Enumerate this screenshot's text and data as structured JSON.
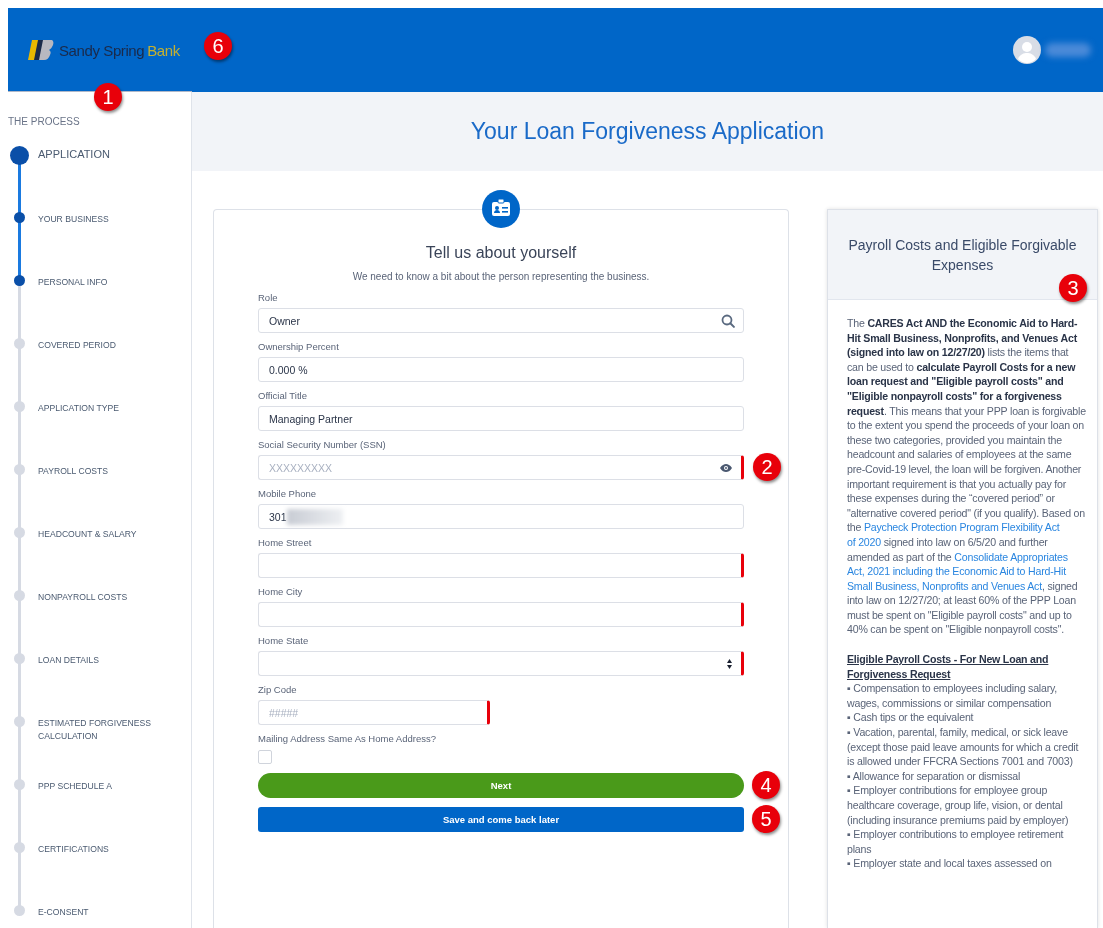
{
  "header": {
    "logo": {
      "text": "Sandy Spring",
      "accent": "Bank"
    },
    "user": {
      "redacted": true
    }
  },
  "sidebar": {
    "title": "THE PROCESS",
    "steps": [
      {
        "label": "APPLICATION",
        "kind": "major",
        "completed": true
      },
      {
        "label": "YOUR BUSINESS",
        "kind": "minor",
        "completed": true
      },
      {
        "label": "PERSONAL INFO",
        "kind": "minor",
        "completed": true
      },
      {
        "label": "COVERED PERIOD",
        "kind": "minor",
        "completed": false
      },
      {
        "label": "APPLICATION TYPE",
        "kind": "minor",
        "completed": false
      },
      {
        "label": "PAYROLL COSTS",
        "kind": "minor",
        "completed": false
      },
      {
        "label": "HEADCOUNT & SALARY",
        "kind": "minor",
        "completed": false
      },
      {
        "label": "NONPAYROLL COSTS",
        "kind": "minor",
        "completed": false
      },
      {
        "label": "LOAN DETAILS",
        "kind": "minor",
        "completed": false
      },
      {
        "label": "ESTIMATED FORGIVENESS CALCULATION",
        "kind": "minor",
        "completed": false
      },
      {
        "label": "PPP SCHEDULE A",
        "kind": "minor",
        "completed": false
      },
      {
        "label": "CERTIFICATIONS",
        "kind": "minor",
        "completed": false
      },
      {
        "label": "E-CONSENT",
        "kind": "minor",
        "completed": false
      }
    ]
  },
  "page_title": "Your Loan Forgiveness Application",
  "form": {
    "heading": "Tell us about yourself",
    "subtitle": "We need to know a bit about the person representing the business.",
    "fields": [
      {
        "label": "Role",
        "kind": "search",
        "value": "Owner",
        "required": false
      },
      {
        "label": "Ownership Percent",
        "kind": "text",
        "value": "0.000 %",
        "required": false
      },
      {
        "label": "Official Title",
        "kind": "text",
        "value": "Managing Partner",
        "required": false
      },
      {
        "label": "Social Security Number (SSN)",
        "kind": "secret",
        "placeholder": "XXXXXXXXX",
        "required": true
      },
      {
        "label": "Mobile Phone",
        "kind": "text",
        "value": "301",
        "redacted": true,
        "required": false
      },
      {
        "label": "Home Street",
        "kind": "text",
        "required": true
      },
      {
        "label": "Home City",
        "kind": "text",
        "required": true
      },
      {
        "label": "Home State",
        "kind": "select",
        "required": true
      },
      {
        "label": "Zip Code",
        "kind": "short",
        "placeholder": "#####",
        "required": true
      }
    ],
    "checkbox": {
      "label": "Mailing Address Same As Home Address?",
      "checked": false
    },
    "buttons": [
      {
        "label": "Next",
        "kind": "primary"
      },
      {
        "label": "Save and come back later",
        "kind": "secondary"
      }
    ]
  },
  "info_panel": {
    "title": "Payroll Costs and Eligible Forgivable Expenses",
    "intro": [
      {
        "kind": "text",
        "text": "The "
      },
      {
        "kind": "bold",
        "text": "CARES Act AND the Economic Aid to Hard-Hit Small Business, Nonprofits, and Venues Act  (signed into law on 12/27/20)"
      },
      {
        "kind": "text",
        "text": " lists the items that can be used to "
      },
      {
        "kind": "bold",
        "text": "calculate Payroll Costs for a new loan request and \"Eligible payroll costs\" and \"Eligible nonpayroll costs\" for a forgiveness request"
      },
      {
        "kind": "text",
        "text": ". This means that your PPP loan is forgivable to the extent you spend the proceeds of your loan on these two categories, provided you maintain the headcount and salaries of employees at the same pre-Covid-19 level, the loan will be forgiven. Another important requirement is that you actually pay for these expenses during the “covered period” or \"alternative covered period\" (if you qualify).  Based on the "
      },
      {
        "kind": "link",
        "text": "Paycheck Protection Program Flexibility Act "
      },
      {
        "kind": "link",
        "text": "of 2020"
      },
      {
        "kind": "text",
        "text": " signed into law on 6/5/20 and further amended as part of the "
      },
      {
        "kind": "link",
        "text": "Consolidate Appropriates "
      },
      {
        "kind": "link",
        "text": "Act, 2021 including the Economic Aid to Hard-Hit "
      },
      {
        "kind": "link",
        "text": "Small Business, Nonprofits and Venues Act"
      },
      {
        "kind": "text",
        "text": ", signed into law on 12/27/20; at least 60% of the PPP Loan must be spent on \"Eligible payroll costs\" and up to 40% can be spent on \"Eligible nonpayroll costs\"."
      }
    ],
    "section_heading": "Eligible Payroll Costs - For New Loan and Forgiveness Request",
    "bullets": [
      "▪   Compensation to employees including salary, wages, commissions or similar compensation",
      "▪   Cash tips or the equivalent",
      "▪   Vacation, parental, family, medical, or sick leave (except those paid leave amounts for which a credit is allowed under FFCRA Sections 7001 and 7003)",
      "▪   Allowance for separation or dismissal",
      "▪   Employer contributions for employee group healthcare coverage, group life, vision, or dental (including insurance premiums paid by employer)",
      "▪   Employer contributions to employee retirement plans",
      "▪   Employer state and local taxes assessed on"
    ]
  },
  "annotations": [
    {
      "text": "1"
    },
    {
      "text": "2"
    },
    {
      "text": "3"
    },
    {
      "text": "4"
    },
    {
      "text": "5"
    },
    {
      "text": "6"
    }
  ]
}
